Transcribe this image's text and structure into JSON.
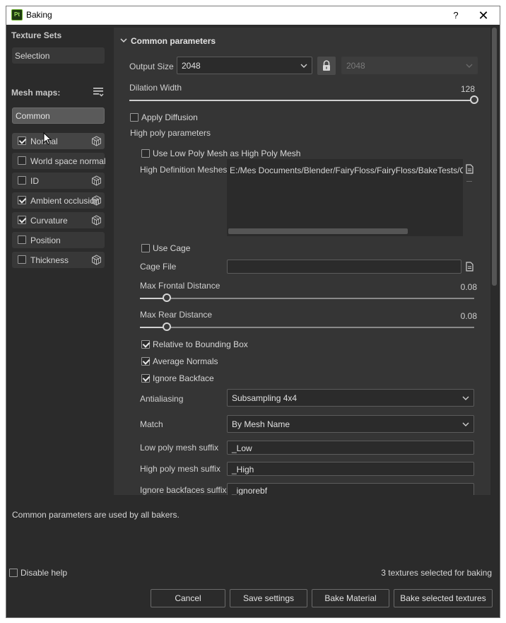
{
  "window": {
    "title": "Baking",
    "logo_text": "Pt",
    "help_glyph": "?",
    "close_glyph": "✕"
  },
  "left": {
    "texture_sets_label": "Texture Sets",
    "selection_label": "Selection",
    "mesh_maps_label": "Mesh maps:",
    "common_label": "Common",
    "maps": [
      {
        "label": "Normal",
        "checked": true,
        "cube": true
      },
      {
        "label": "World space normal",
        "checked": false,
        "cube": false
      },
      {
        "label": "ID",
        "checked": false,
        "cube": true
      },
      {
        "label": "Ambient occlusion",
        "checked": true,
        "cube": true
      },
      {
        "label": "Curvature",
        "checked": true,
        "cube": true
      },
      {
        "label": "Position",
        "checked": false,
        "cube": false
      },
      {
        "label": "Thickness",
        "checked": false,
        "cube": true
      }
    ]
  },
  "common": {
    "section_title": "Common parameters",
    "output_size_label": "Output Size",
    "output_size_value": "2048",
    "output_size_locked_value": "2048",
    "dilation_label": "Dilation Width",
    "dilation_value": "128",
    "dilation_fraction": 1.0,
    "apply_diffusion_label": "Apply Diffusion",
    "apply_diffusion_checked": false,
    "high_poly_params_label": "High poly parameters",
    "use_low_poly_label": "Use Low Poly Mesh as High Poly Mesh",
    "use_low_poly_checked": false,
    "high_def_meshes_label": "High Definition Meshes",
    "high_def_meshes_value": "E:/Mes Documents/Blender/FairyFloss/FairyFloss/BakeTests/Cube",
    "use_cage_label": "Use Cage",
    "use_cage_checked": false,
    "cage_file_label": "Cage File",
    "cage_file_value": "",
    "max_frontal_label": "Max Frontal Distance",
    "max_frontal_value": "0.08",
    "max_frontal_fraction": 0.08,
    "max_rear_label": "Max Rear Distance",
    "max_rear_value": "0.08",
    "max_rear_fraction": 0.08,
    "relative_bbox_label": "Relative to Bounding Box",
    "relative_bbox_checked": true,
    "average_normals_label": "Average Normals",
    "average_normals_checked": true,
    "ignore_backface_label": "Ignore Backface",
    "ignore_backface_checked": true,
    "antialiasing_label": "Antialiasing",
    "antialiasing_value": "Subsampling 4x4",
    "match_label": "Match",
    "match_value": "By Mesh Name",
    "low_suffix_label": "Low poly mesh suffix",
    "low_suffix_value": "_Low",
    "high_suffix_label": "High poly mesh suffix",
    "high_suffix_value": "_High",
    "ignore_bf_suffix_label": "Ignore backfaces suffix",
    "ignore_bf_suffix_value": "_ignorebf"
  },
  "footer": {
    "help_text": "Common parameters are used by all bakers.",
    "disable_help_label": "Disable help",
    "disable_help_checked": false,
    "textures_selected": "3 textures selected for baking",
    "cancel_label": "Cancel",
    "save_settings_label": "Save settings",
    "bake_material_label": "Bake Material",
    "bake_selected_label": "Bake selected textures"
  },
  "icons": {
    "section_chevron": "chevron-down-icon",
    "lock": "lock-icon",
    "file": "file-icon",
    "cube": "cube-icon",
    "list_menu": "list-menu-icon"
  },
  "colors": {
    "panel_bg": "#2b2b2b",
    "content_bg": "#353535",
    "accent_logo": "#6eb22f"
  }
}
